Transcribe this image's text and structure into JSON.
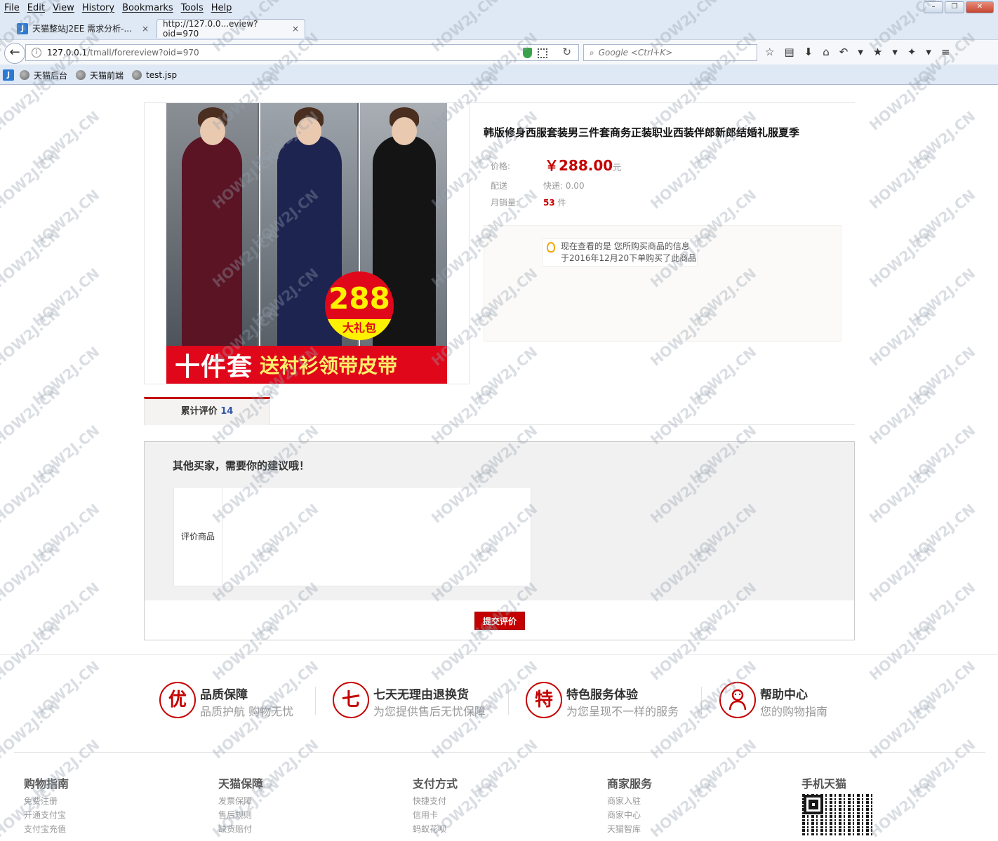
{
  "menu": [
    "File",
    "Edit",
    "View",
    "History",
    "Bookmarks",
    "Tools",
    "Help"
  ],
  "tabs": [
    {
      "title": "天猫整站J2EE 需求分析-...",
      "close": "×"
    },
    {
      "title": "http://127.0.0...eview?oid=970",
      "close": "×"
    }
  ],
  "new_tab": "+",
  "address": {
    "host": "127.0.0.1",
    "path": "/tmall/forereview?oid=970"
  },
  "search": {
    "placeholder": "Google <Ctrl+K>"
  },
  "bookmarks": [
    "天猫后台",
    "天猫前端",
    "test.jsp"
  ],
  "product": {
    "title": "韩版修身西服套装男三件套商务正装职业西装伴郎新郎结婚礼服夏季",
    "price_label": "价格:",
    "price": "￥288.00",
    "price_unit": "元",
    "delivery_label": "配送",
    "delivery_value": "快递: 0.00",
    "sales_label": "月销量:",
    "sales_count": "53",
    "sales_unit": "件",
    "notice_line1": "现在查看的是 您所购买商品的信息",
    "notice_line2": "于2016年12月20下单购买了此商品",
    "image": {
      "badge_number": "288",
      "badge_text": "大礼包",
      "banner_big": "十件套",
      "banner_small": "送衬衫领带皮带"
    }
  },
  "review_tab": {
    "label": "累计评价",
    "count": "14"
  },
  "review_form": {
    "prompt": "其他买家，需要你的建议哦！",
    "field_label": "评价商品",
    "submit": "提交评价"
  },
  "guarantees": [
    {
      "icon": "优",
      "title": "品质保障",
      "subtitle": "品质护航 购物无忧"
    },
    {
      "icon": "七",
      "title": "七天无理由退换货",
      "subtitle": "为您提供售后无忧保障"
    },
    {
      "icon": "特",
      "title": "特色服务体验",
      "subtitle": "为您呈现不一样的服务"
    },
    {
      "icon": "person-icon",
      "title": "帮助中心",
      "subtitle": "您的购物指南"
    }
  ],
  "footer": [
    {
      "heading": "购物指南",
      "items": [
        "免费注册",
        "开通支付宝",
        "支付宝充值"
      ]
    },
    {
      "heading": "天猫保障",
      "items": [
        "发票保障",
        "售后规则",
        "缺货赔付"
      ]
    },
    {
      "heading": "支付方式",
      "items": [
        "快捷支付",
        "信用卡",
        "蚂蚁花呗"
      ]
    },
    {
      "heading": "商家服务",
      "items": [
        "商家入驻",
        "商家中心",
        "天猫智库"
      ]
    },
    {
      "heading": "手机天猫",
      "items": []
    }
  ],
  "watermark_text": "HOW2J.CN",
  "colors": {
    "accent": "#c40000",
    "chrome": "#dfe8f5",
    "form_bg": "#f1f1f1"
  }
}
